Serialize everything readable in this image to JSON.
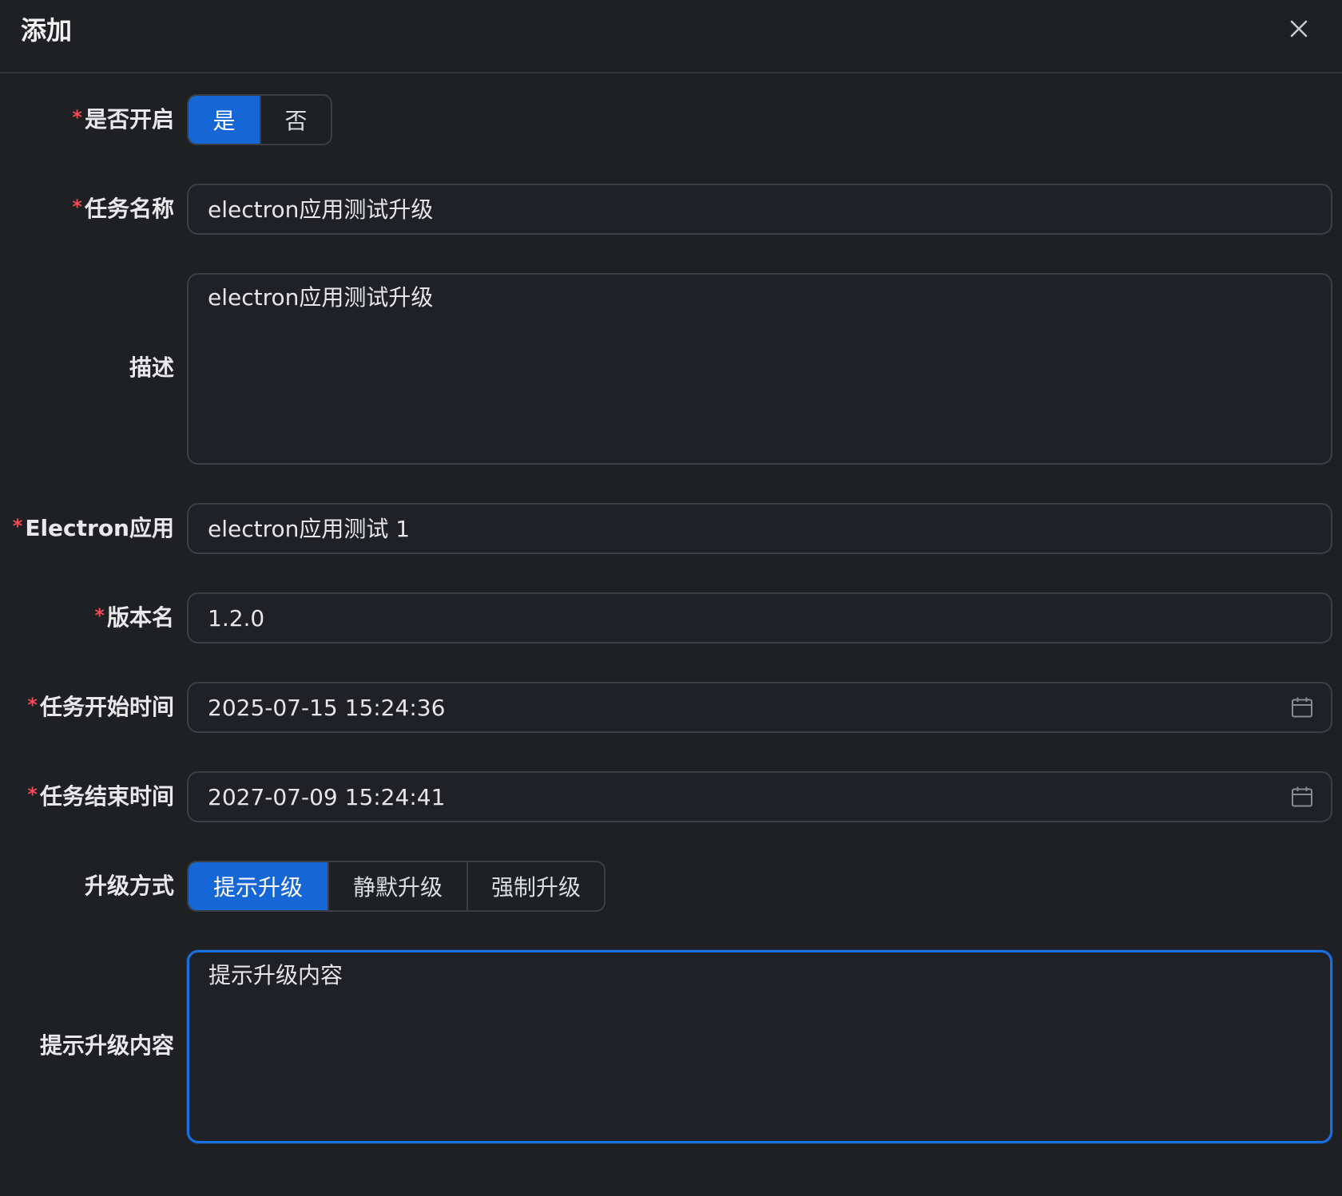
{
  "dialog": {
    "title": "添加"
  },
  "form": {
    "enabled": {
      "label": "是否开启",
      "required": "*",
      "options": [
        "是",
        "否"
      ],
      "selected": "是"
    },
    "task_name": {
      "label": "任务名称",
      "required": "*",
      "value": "electron应用测试升级"
    },
    "description": {
      "label": "描述",
      "value": "electron应用测试升级"
    },
    "electron_app": {
      "label": "Electron应用",
      "required": "*",
      "value": "electron应用测试 1"
    },
    "version_name": {
      "label": "版本名",
      "required": "*",
      "value": "1.2.0"
    },
    "start_time": {
      "label": "任务开始时间",
      "required": "*",
      "value": "2025-07-15 15:24:36"
    },
    "end_time": {
      "label": "任务结束时间",
      "required": "*",
      "value": "2027-07-09 15:24:41"
    },
    "upgrade_mode": {
      "label": "升级方式",
      "options": [
        "提示升级",
        "静默升级",
        "强制升级"
      ],
      "selected": "提示升级"
    },
    "prompt_content": {
      "label": "提示升级内容",
      "value": "提示升级内容"
    }
  },
  "icons": {
    "close": "close-icon",
    "calendar": "calendar-icon"
  },
  "colors": {
    "background": "#1e2024",
    "accent": "#1666d6",
    "required": "#f04a55",
    "border": "#3b3e45",
    "focus_border": "#1a6fe0"
  }
}
